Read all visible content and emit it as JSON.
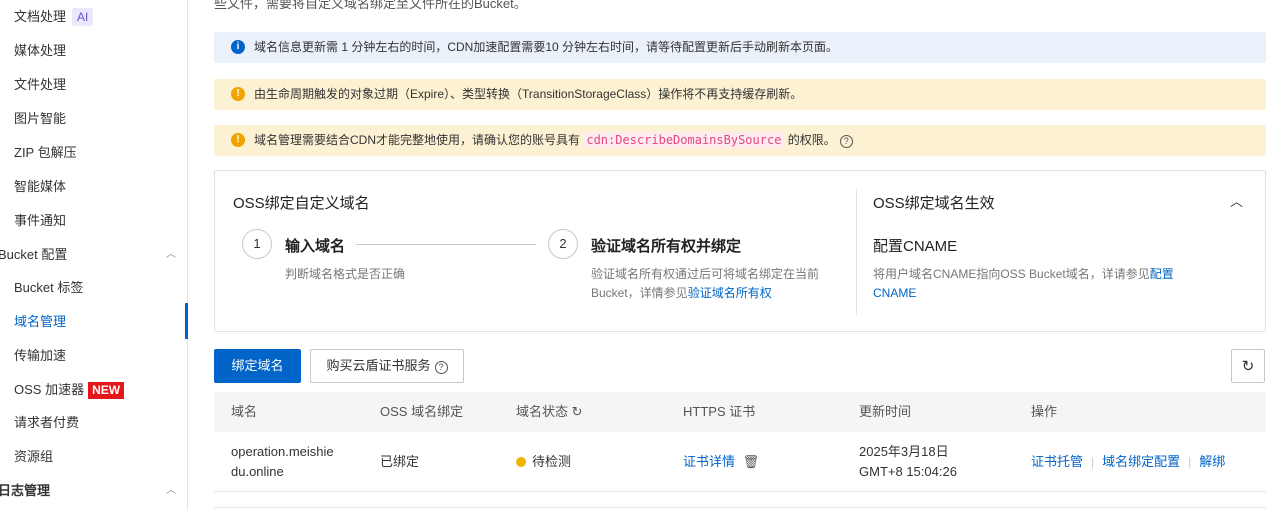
{
  "sidebar": {
    "items": [
      {
        "label": "文档处理",
        "badge": "AI"
      },
      {
        "label": "媒体处理"
      },
      {
        "label": "文件处理"
      },
      {
        "label": "图片智能"
      },
      {
        "label": "ZIP 包解压"
      },
      {
        "label": "智能媒体"
      },
      {
        "label": "事件通知"
      },
      {
        "label": "Bucket 配置",
        "group": true,
        "expanded": true
      },
      {
        "label": "Bucket 标签"
      },
      {
        "label": "域名管理",
        "active": true
      },
      {
        "label": "传输加速"
      },
      {
        "label": "OSS 加速器",
        "badge": "NEW"
      },
      {
        "label": "请求者付费"
      },
      {
        "label": "资源组"
      },
      {
        "label": "日志管理",
        "group": true,
        "expanded": true
      }
    ]
  },
  "intro_text": "些文件，需要将自定义域名绑定至文件所在的Bucket。",
  "alerts": {
    "info": "域名信息更新需 1 分钟左右的时间，CDN加速配置需要10 分钟左右时间，请等待配置更新后手动刷新本页面。",
    "warn1": "由生命周期触发的对象过期（Expire）、类型转换（TransitionStorageClass）操作将不再支持缓存刷新。",
    "warn2_prefix": "域名管理需要结合CDN才能完整地使用，请确认您的账号具有",
    "warn2_code": "cdn:DescribeDomainsBySource",
    "warn2_suffix": "的权限。"
  },
  "panel": {
    "left_title": "OSS绑定自定义域名",
    "steps": [
      {
        "num": "1",
        "title": "输入域名",
        "desc": "判断域名格式是否正确"
      },
      {
        "num": "2",
        "title": "验证域名所有权并绑定",
        "desc_line1": "验证域名所有权通过后可将域名绑定在当前",
        "desc_line2_prefix": "Bucket，详情参见",
        "desc_link": "验证域名所有权"
      }
    ],
    "right_title": "OSS绑定域名生效",
    "right_subtitle": "配置CNAME",
    "right_desc": "将用户域名CNAME指向OSS Bucket域名，详请参见",
    "right_link_1": "配置",
    "right_link_2": "CNAME"
  },
  "toolbar": {
    "bind_button": "绑定域名",
    "buy_button": "购买云盾证书服务"
  },
  "table": {
    "headers": [
      "域名",
      "OSS 域名绑定",
      "域名状态",
      "HTTPS 证书",
      "更新时间",
      "操作"
    ],
    "rows": [
      {
        "domain_line1": "operation.meishie",
        "domain_line2": "du.online",
        "binding": "已绑定",
        "status": "待检测",
        "https": "证书详情",
        "updated_line1": "2025年3月18日",
        "updated_line2": "GMT+8 15:04:26",
        "actions": [
          "证书托管",
          "域名绑定配置",
          "解绑"
        ]
      }
    ]
  },
  "colors": {
    "primary": "#0064c8",
    "info_bg": "#eaf1fb",
    "warn_bg": "#fcf1d2",
    "warn_icon": "#f0a400",
    "status_pending": "#f0b400",
    "badge_new": "#e4161a"
  }
}
